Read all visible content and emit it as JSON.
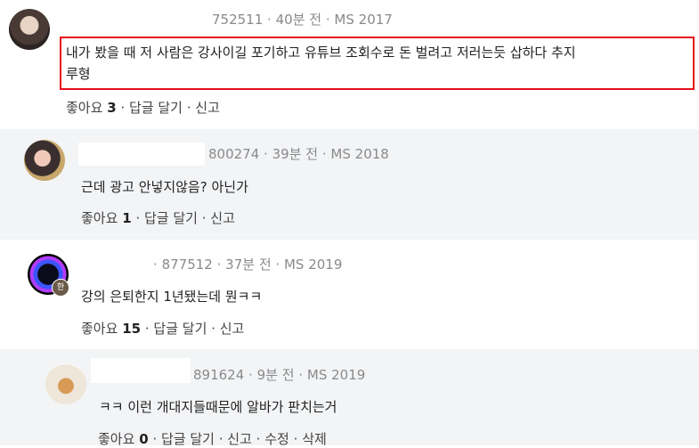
{
  "comments": [
    {
      "id_num": "752511",
      "time": "40분 전",
      "cls": "MS 2017",
      "text_line1": "내가 봤을 때 저 사람은 강사이길 포기하고 유튜브 조회수로 돈 벌려고 저러는듯 삽하다 추지",
      "text_line2": "루형",
      "likes_label": "좋아요",
      "likes": "3",
      "reply": "답글 달기",
      "report": "신고",
      "separator": "·"
    },
    {
      "id_num": "800274",
      "time": "39분 전",
      "cls": "MS 2018",
      "text": "근데 광고 안넣지않음? 아닌가",
      "likes_label": "좋아요",
      "likes": "1",
      "reply": "답글 달기",
      "report": "신고",
      "separator": "·"
    },
    {
      "id_num": "877512",
      "time": "37분 전",
      "cls": "MS 2019",
      "text": "강의 은퇴한지 1년됐는데 뭔ㅋㅋ",
      "badge": "한",
      "likes_label": "좋아요",
      "likes": "15",
      "reply": "답글 달기",
      "report": "신고",
      "separator": "·"
    },
    {
      "id_num": "891624",
      "time": "9분 전",
      "cls": "MS 2019",
      "text": "ㅋㅋ 이런 개대지들때문에 알바가 판치는거",
      "likes_label": "좋아요",
      "likes": "0",
      "reply": "답글 달기",
      "report": "신고",
      "edit": "수정",
      "delete": "삭제",
      "separator": "·"
    }
  ],
  "colors": {
    "highlight": "#e8101c",
    "reply_bg": "#f3f4f6",
    "meta": "#8a8a8a"
  }
}
